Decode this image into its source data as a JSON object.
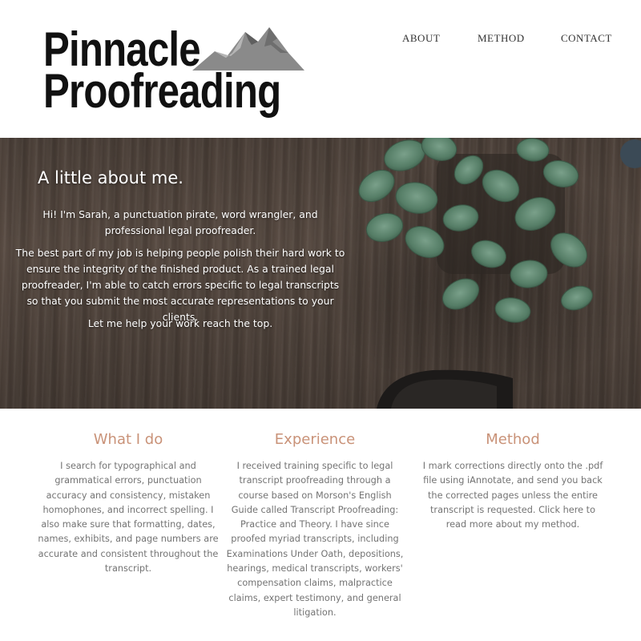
{
  "header": {
    "logo": {
      "line1": "Pinnacle",
      "line2": "Proofreading"
    },
    "nav": [
      {
        "label": "ABOUT"
      },
      {
        "label": "METHOD"
      },
      {
        "label": "CONTACT"
      }
    ]
  },
  "hero": {
    "title": "A little about me.",
    "paragraphs": [
      "Hi! I'm Sarah, a punctuation pirate, word wrangler, and professional legal proofreader.",
      "The best part of my job is helping people polish their hard work to ensure the integrity of the finished product. As a trained legal proofreader, I'm able to catch errors specific to legal transcripts so that you submit the most accurate representations to your clients.",
      "Let me help your work reach the top."
    ]
  },
  "columns": [
    {
      "title": "What I do",
      "text": "I search for typographical and grammatical errors, punctuation accuracy and consistency, mistaken homophones, and incorrect spelling. I also make sure that formatting, dates, names, exhibits, and page numbers are accurate and consistent throughout the transcript."
    },
    {
      "title": "Experience",
      "text": "I received training specific to legal transcript proofreading through a course based on Morson's English Guide called Transcript Proofreading: Practice and Theory. I have since proofed myriad transcripts, including Examinations Under Oath, depositions, hearings, medical transcripts, workers' compensation claims, malpractice claims, expert testimony, and general litigation."
    },
    {
      "title": "Method",
      "text": "I mark corrections directly onto the .pdf file using iAnnotate, and send you back the corrected pages unless the entire transcript is requested. Click here to read more about my method."
    }
  ],
  "colors": {
    "accent": "#c99278",
    "body_text": "#737373",
    "nav_text": "#333333",
    "hero_wood": "#56493f",
    "plant_leaf": "#5f8a72"
  }
}
